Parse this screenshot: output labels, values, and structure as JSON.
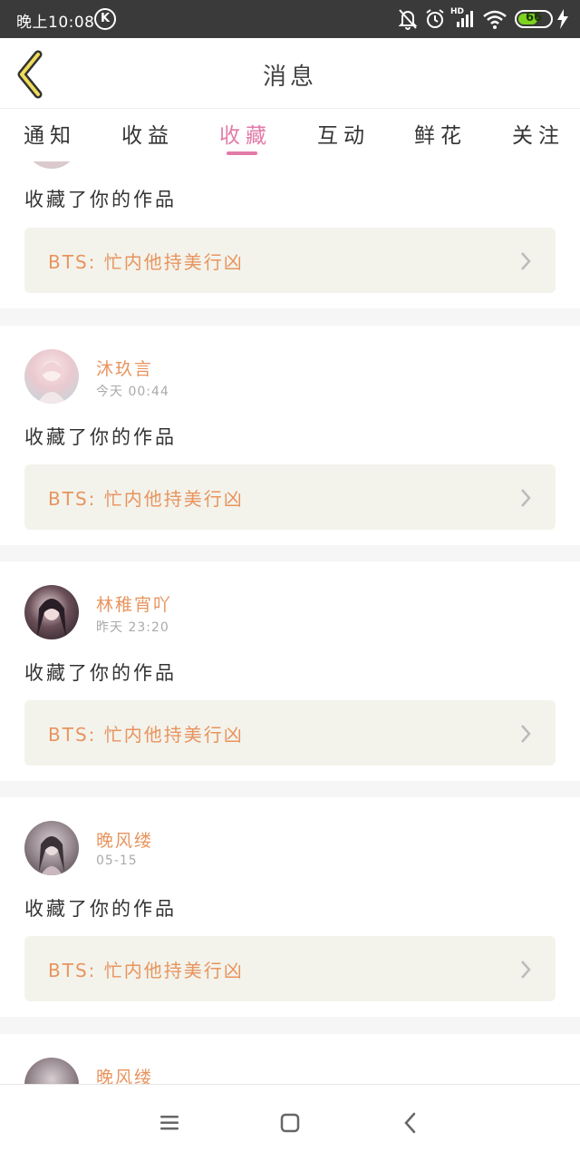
{
  "status_bar": {
    "time": "晚上10:08",
    "app_badge": "K",
    "battery_level": "66",
    "battery_fraction": 0.66,
    "network_label": "HD"
  },
  "header": {
    "title": "消息"
  },
  "tabs": [
    {
      "label": "通知",
      "active": false
    },
    {
      "label": "收益",
      "active": false
    },
    {
      "label": "收藏",
      "active": true
    },
    {
      "label": "互动",
      "active": false
    },
    {
      "label": "鲜花",
      "active": false
    },
    {
      "label": "关注",
      "active": false
    }
  ],
  "feed": {
    "items": [
      {
        "action": "收藏了你的作品",
        "work_title": "BTS: 忙内他持美行凶"
      },
      {
        "username": "沐玖言",
        "time": "今天 00:44",
        "action": "收藏了你的作品",
        "work_title": "BTS: 忙内他持美行凶"
      },
      {
        "username": "林稚宵吖",
        "time": "昨天 23:20",
        "action": "收藏了你的作品",
        "work_title": "BTS: 忙内他持美行凶"
      },
      {
        "username": "晚风缕",
        "time": "05-15",
        "action": "收藏了你的作品",
        "work_title": "BTS: 忙内他持美行凶"
      },
      {
        "username": "晚风缕"
      }
    ]
  },
  "colors": {
    "accent_pink": "#e27ba8",
    "accent_orange": "#e8945e",
    "card_box": "#f3f3ec"
  },
  "icons": {
    "back": "chevron-left-icon",
    "chevron": "chevron-right-icon",
    "nav_menu": "menu-icon",
    "nav_home": "square-icon",
    "nav_back": "back-icon"
  }
}
